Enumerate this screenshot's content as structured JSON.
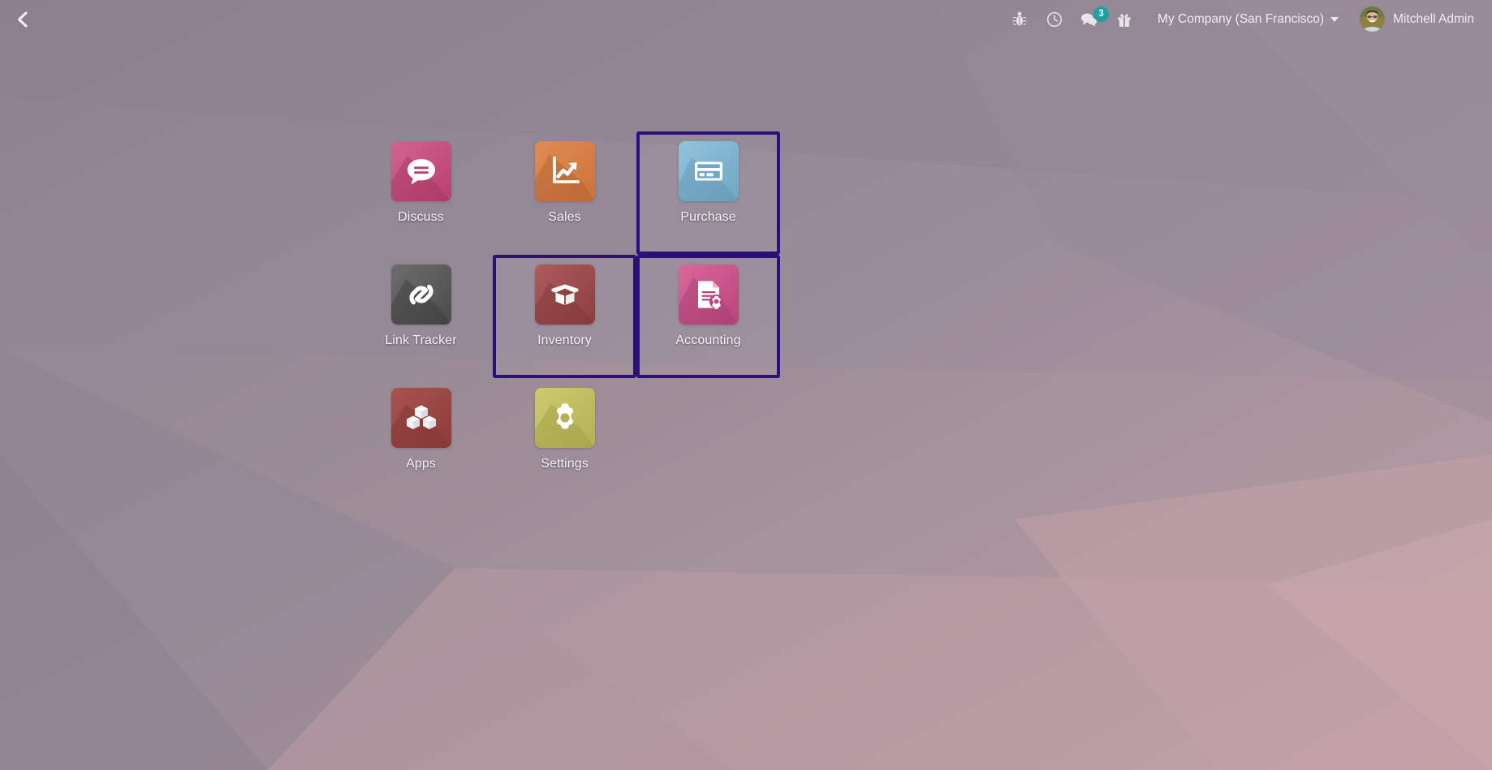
{
  "topbar": {
    "back_icon": "chevron-left-icon",
    "back_label": "Back",
    "sys_icons": [
      {
        "name": "bug-icon",
        "label": "Debug"
      },
      {
        "name": "clock-icon",
        "label": "Activities"
      },
      {
        "name": "chat-icon",
        "label": "Messages",
        "badge": "3"
      },
      {
        "name": "gift-icon",
        "label": "What's new"
      }
    ],
    "messages_badge": "3",
    "company": "My Company (San Francisco)",
    "company_caret": "chevron-down-icon",
    "user": "Mitchell Admin",
    "avatar_name": "avatar"
  },
  "colors": {
    "accent_badge": "#10a4a4",
    "selection_border": "#2c0f77",
    "desktop_base": "#8d8292",
    "label_text": "#f5f2f6"
  },
  "apps": [
    {
      "id": "discuss",
      "label": "Discuss",
      "icon": "speech-bubble-icon",
      "selected": false,
      "bg_from": "#d4638f",
      "bg_to": "#b8416e",
      "shadow": "#a63a63"
    },
    {
      "id": "sales",
      "label": "Sales",
      "icon": "line-chart-up-icon",
      "selected": false,
      "bg_from": "#e08b55",
      "bg_to": "#cd7339",
      "shadow": "#a85c2d"
    },
    {
      "id": "purchase",
      "label": "Purchase",
      "icon": "credit-card-icon",
      "selected": true,
      "bg_from": "#93c3dc",
      "bg_to": "#6fa7c4",
      "shadow": "#5c90ab"
    },
    {
      "id": "link-tracker",
      "label": "Link Tracker",
      "icon": "chain-link-icon",
      "selected": false,
      "bg_from": "#6d6d6d",
      "bg_to": "#4b4b4b",
      "shadow": "#3e3e3e"
    },
    {
      "id": "inventory",
      "label": "Inventory",
      "icon": "open-box-icon",
      "selected": true,
      "bg_from": "#ad5b5b",
      "bg_to": "#8c3f3f",
      "shadow": "#7a3636"
    },
    {
      "id": "accounting",
      "label": "Accounting",
      "icon": "document-gear-icon",
      "selected": true,
      "bg_from": "#d9689b",
      "bg_to": "#b8457b",
      "shadow": "#a03a6b"
    },
    {
      "id": "apps",
      "label": "Apps",
      "icon": "cubes-icon",
      "selected": false,
      "bg_from": "#a9534f",
      "bg_to": "#8d3b39",
      "shadow": "#7c3331"
    },
    {
      "id": "settings",
      "label": "Settings",
      "icon": "gear-icon",
      "selected": false,
      "bg_from": "#cdcb6e",
      "bg_to": "#b3b054",
      "shadow": "#9b9847"
    }
  ]
}
